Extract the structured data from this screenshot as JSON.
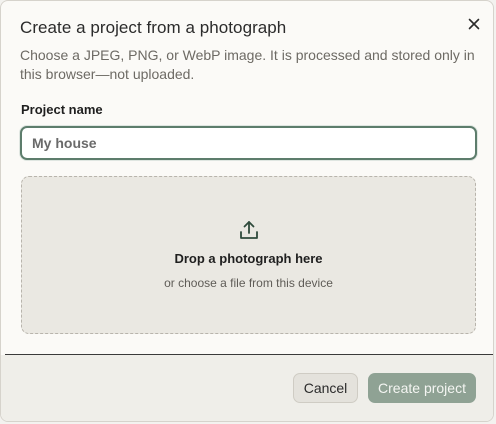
{
  "dialog": {
    "title": "Create a project from a photograph",
    "subtitle": "Choose a JPEG, PNG, or WebP image. It is processed and stored only in this browser—not uploaded.",
    "close_icon": "close-icon"
  },
  "form": {
    "project_name_label": "Project name",
    "project_name_placeholder": "My house",
    "project_name_value": ""
  },
  "dropzone": {
    "icon": "upload-icon",
    "title": "Drop a photograph here",
    "subtitle": "or choose a file from this device"
  },
  "footer": {
    "cancel_label": "Cancel",
    "create_label": "Create project"
  },
  "colors": {
    "accent": "#5d7d6c",
    "create_button": "#8fa294",
    "dropzone_bg": "#eae8e2"
  }
}
